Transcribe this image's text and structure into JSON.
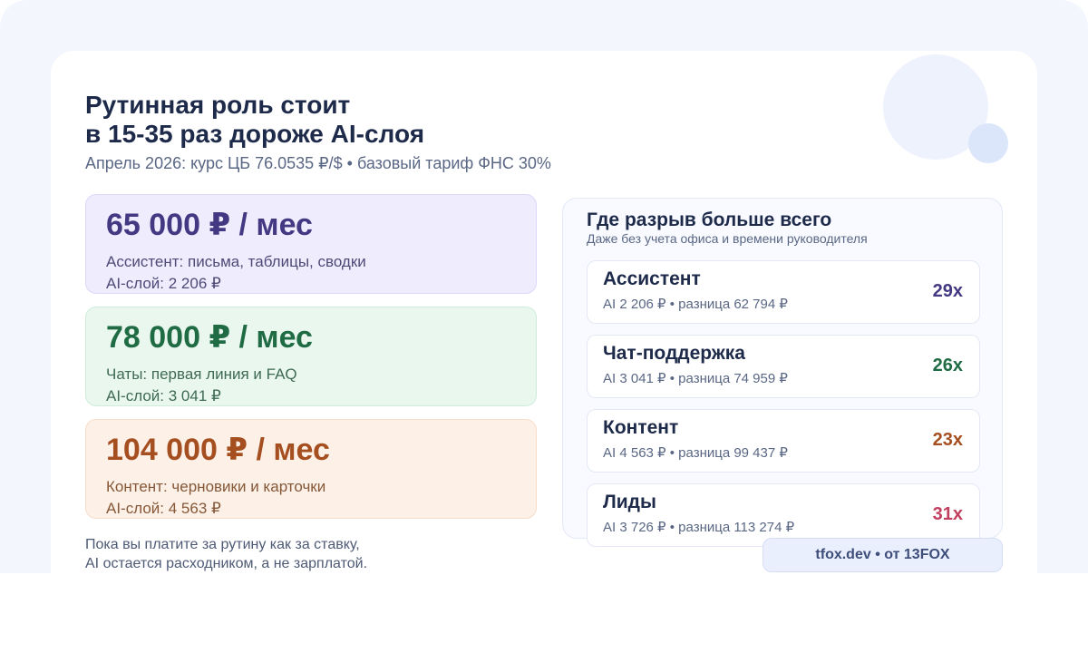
{
  "header": {
    "title_line1": "Рутинная роль стоит",
    "title_line2": "в 15-35 раз дороже AI-слоя",
    "subtitle": "Апрель 2026: курс ЦБ 76.0535 ₽/$ • базовый тариф ФНС 30%"
  },
  "price_cards": [
    {
      "amount": "65 000 ₽ / мес",
      "desc": "Ассистент: письма, таблицы, сводки",
      "ai": "AI-слой: 2 206 ₽",
      "accent": "#433983"
    },
    {
      "amount": "78 000 ₽ / мес",
      "desc": "Чаты: первая линия и FAQ",
      "ai": "AI-слой: 3 041 ₽",
      "accent": "#1f6b43"
    },
    {
      "amount": "104 000 ₽ / мес",
      "desc": "Контент: черновики и карточки",
      "ai": "AI-слой: 4 563 ₽",
      "accent": "#a54f20"
    }
  ],
  "note": {
    "line1": "Пока вы платите за рутину как за ставку,",
    "line2": "AI остается расходником, а не зарплатой."
  },
  "gap_panel": {
    "title": "Где разрыв больше всего",
    "subtitle": "Даже без учета офиса и времени руководителя",
    "rows": [
      {
        "role": "Ассистент",
        "detail": "AI 2 206 ₽ • разница 62 794 ₽",
        "multiplier": "29x",
        "color": "#433983"
      },
      {
        "role": "Чат-поддержка",
        "detail": "AI 3 041 ₽ • разница 74 959 ₽",
        "multiplier": "26x",
        "color": "#1f6b43"
      },
      {
        "role": "Контент",
        "detail": "AI 4 563 ₽ • разница 99 437 ₽",
        "multiplier": "23x",
        "color": "#a54f20"
      },
      {
        "role": "Лиды",
        "detail": "AI 3 726 ₽ • разница 113 274 ₽",
        "multiplier": "31x",
        "color": "#c2405f"
      }
    ]
  },
  "footer": {
    "badge": "tfox.dev • от 13FOX"
  }
}
